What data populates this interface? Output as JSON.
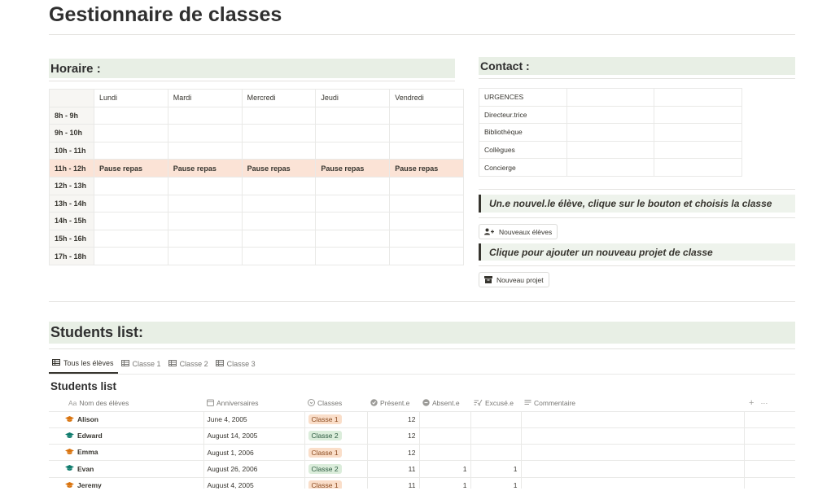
{
  "page": {
    "title": "Gestionnaire de classes"
  },
  "schedule": {
    "heading": "Horaire :",
    "days": [
      "Lundi",
      "Mardi",
      "Mercredi",
      "Jeudi",
      "Vendredi"
    ],
    "rows": [
      {
        "time": "8h - 9h",
        "cells": [
          "",
          "",
          "",
          "",
          ""
        ]
      },
      {
        "time": "9h - 10h",
        "cells": [
          "",
          "",
          "",
          "",
          ""
        ]
      },
      {
        "time": "10h - 11h",
        "cells": [
          "",
          "",
          "",
          "",
          ""
        ]
      },
      {
        "time": "11h - 12h",
        "cells": [
          "Pause repas",
          "Pause repas",
          "Pause repas",
          "Pause repas",
          "Pause repas"
        ],
        "highlight": true
      },
      {
        "time": "12h - 13h",
        "cells": [
          "",
          "",
          "",
          "",
          ""
        ]
      },
      {
        "time": "13h - 14h",
        "cells": [
          "",
          "",
          "",
          "",
          ""
        ]
      },
      {
        "time": "14h - 15h",
        "cells": [
          "",
          "",
          "",
          "",
          ""
        ]
      },
      {
        "time": "15h - 16h",
        "cells": [
          "",
          "",
          "",
          "",
          ""
        ]
      },
      {
        "time": "17h - 18h",
        "cells": [
          "",
          "",
          "",
          "",
          ""
        ]
      }
    ]
  },
  "contact": {
    "heading": "Contact :",
    "rows": [
      "URGENCES",
      "Directeur.trice",
      "Bibliothèque",
      "Collègues",
      "Concierge"
    ]
  },
  "callouts": {
    "new_student": "Un.e nouvel.le élève, clique sur le bouton et choisis la classe",
    "new_project": "Clique pour ajouter un nouveau projet de classe"
  },
  "buttons": {
    "new_students": "Nouveaux élèves",
    "new_project": "Nouveau projet"
  },
  "students": {
    "heading": "Students list:",
    "tabs": [
      "Tous les élèves",
      "Classe 1",
      "Classe 2",
      "Classe 3"
    ],
    "db_title": "Students list",
    "columns": [
      "Nom des élèves",
      "Anniversaires",
      "Classes",
      "Présent.e",
      "Absent.e",
      "Excusé.e",
      "Commentaire"
    ],
    "col_prefix": "Aa",
    "add_col": "+",
    "more": "···",
    "rows": [
      {
        "name": "Alison",
        "birthday": "June 4, 2005",
        "class": "Classe 1",
        "present": "12",
        "absent": "",
        "excused": "",
        "comment": ""
      },
      {
        "name": "Edward",
        "birthday": "August 14, 2005",
        "class": "Classe 2",
        "present": "12",
        "absent": "",
        "excused": "",
        "comment": ""
      },
      {
        "name": "Emma",
        "birthday": "August 1, 2006",
        "class": "Classe 1",
        "present": "12",
        "absent": "",
        "excused": "",
        "comment": ""
      },
      {
        "name": "Evan",
        "birthday": "August 26, 2006",
        "class": "Classe 2",
        "present": "11",
        "absent": "1",
        "excused": "1",
        "comment": ""
      },
      {
        "name": "Jeremy",
        "birthday": "August 4, 2005",
        "class": "Classe 1",
        "present": "11",
        "absent": "1",
        "excused": "1",
        "comment": ""
      }
    ]
  },
  "colors": {
    "band": "#e8efe5",
    "lunch": "#fbe3d6",
    "classe1_bg": "#fadec9",
    "classe1_fg": "#8a4a1f",
    "classe2_bg": "#dbeddb",
    "classe2_fg": "#2b593f",
    "cap1": "#d9730d",
    "cap2": "#0f7b6c"
  },
  "icons": {
    "tab": "table-icon",
    "name_col": "text-icon",
    "birthday_col": "calendar-icon",
    "classes_col": "select-icon",
    "present_col": "check-circle-icon",
    "absent_col": "minus-circle-icon",
    "excused_col": "formula-icon",
    "comment_col": "lines-icon",
    "row": "graduation-cap-icon"
  }
}
